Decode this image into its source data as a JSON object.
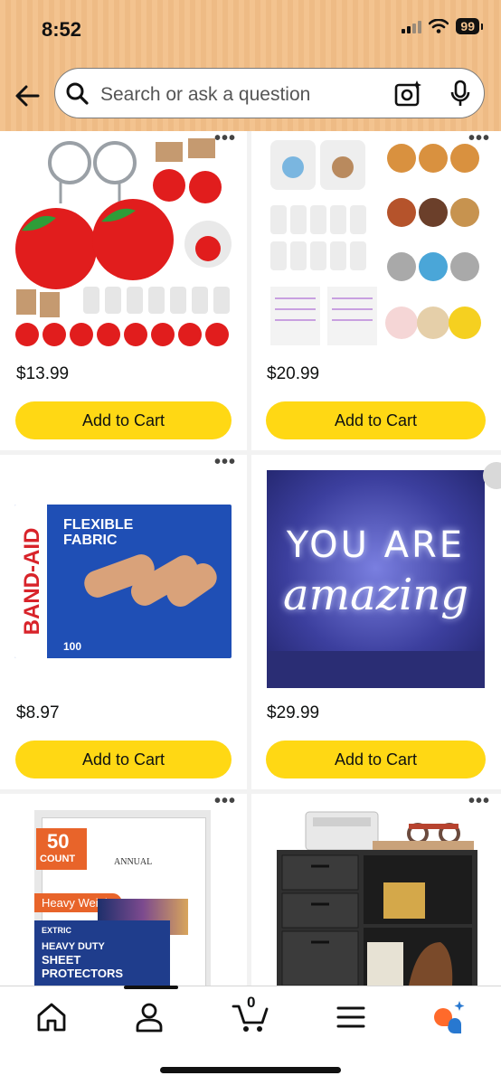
{
  "status": {
    "time": "8:52",
    "battery": "99"
  },
  "search": {
    "placeholder": "Search or ask a question"
  },
  "products": [
    {
      "price": "$13.99",
      "button": "Add to Cart"
    },
    {
      "price": "$20.99",
      "button": "Add to Cart"
    },
    {
      "price": "$8.97",
      "button": "Add to Cart",
      "brand": "BAND-AID",
      "title1": "FLEXIBLE",
      "title2": "FABRIC",
      "count": "100"
    },
    {
      "price": "$29.99",
      "button": "Add to Cart",
      "line1": "YOU ARE",
      "line2": "amazing"
    },
    {
      "count": "50",
      "count_unit": "COUNT",
      "label1": "ANNUAL",
      "weight": "Heavy Weight",
      "brand": "EXTRIC",
      "line1": "HEAVY DUTY",
      "line2": "SHEET",
      "line3": "PROTECTORS"
    },
    {}
  ],
  "tabs": {
    "cart_count": "0"
  },
  "colors": {
    "cta": "#ffd814",
    "header": "#f3c38f",
    "rufus": "#ff6a2b"
  }
}
